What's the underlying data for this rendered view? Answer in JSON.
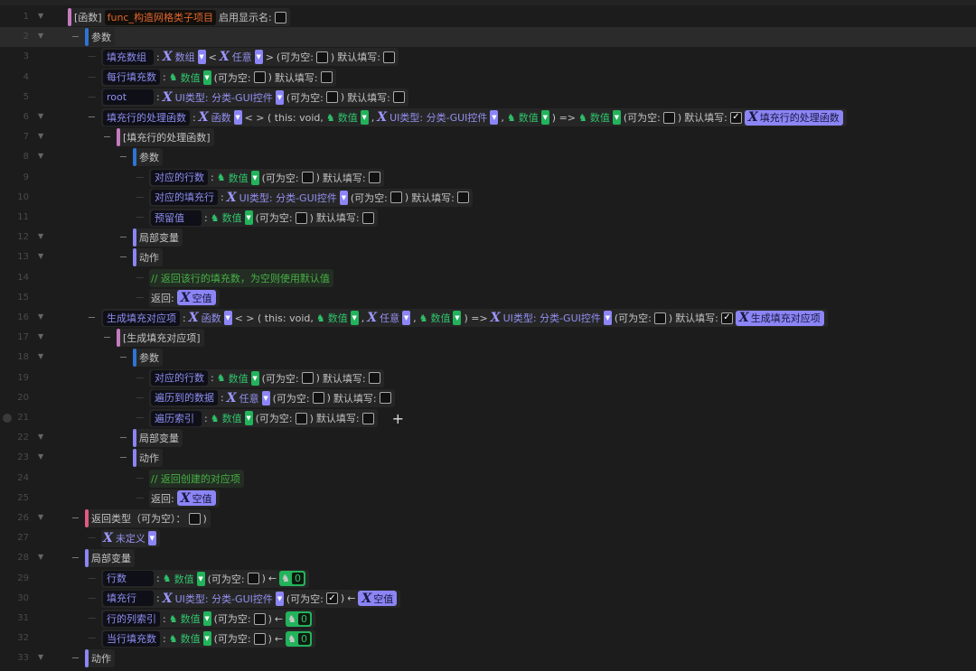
{
  "colors": {
    "pink": "#c57bc0",
    "blue": "#2e74d6",
    "purple": "#8b85f5",
    "red": "#e05a80",
    "accent_x": "#9d97ff",
    "accent_num": "#22b35b",
    "func_name": "#e0672b"
  },
  "rows": [
    {
      "n": "1",
      "lvl": 0,
      "fold": true,
      "bar": "pink",
      "segs": [
        {
          "k": "txt",
          "v": "[函数]"
        },
        {
          "k": "fname",
          "v": "func_构造网格类子项目"
        },
        {
          "k": "txt",
          "v": "启用显示名:"
        },
        {
          "k": "cb"
        }
      ]
    },
    {
      "n": "2",
      "lvl": 1,
      "fold": true,
      "dash": true,
      "hl": true,
      "bar": "blue",
      "segs": [
        {
          "k": "txt",
          "v": "参数"
        }
      ]
    },
    {
      "n": "3",
      "lvl": 2,
      "segs": [
        {
          "k": "name",
          "v": "填充数组"
        },
        {
          "k": "txt",
          "v": ":"
        },
        {
          "k": "x",
          "v": "数组"
        },
        {
          "k": "txt",
          "v": "<"
        },
        {
          "k": "x",
          "v": "任意"
        },
        {
          "k": "txt",
          "v": ">"
        },
        {
          "k": "txt",
          "v": "(可为空:"
        },
        {
          "k": "cb"
        },
        {
          "k": "txt",
          "v": ")"
        },
        {
          "k": "txt",
          "v": "默认填写:"
        },
        {
          "k": "cb"
        }
      ]
    },
    {
      "n": "4",
      "lvl": 2,
      "segs": [
        {
          "k": "name",
          "v": "每行填充数"
        },
        {
          "k": "txt",
          "v": ":"
        },
        {
          "k": "num",
          "v": "数值"
        },
        {
          "k": "txt",
          "v": "(可为空:"
        },
        {
          "k": "cb"
        },
        {
          "k": "txt",
          "v": ")"
        },
        {
          "k": "txt",
          "v": "默认填写:"
        },
        {
          "k": "cb"
        }
      ]
    },
    {
      "n": "5",
      "lvl": 2,
      "segs": [
        {
          "k": "name",
          "v": "root"
        },
        {
          "k": "txt",
          "v": ":"
        },
        {
          "k": "x",
          "v": "UI类型: 分类-GUI控件"
        },
        {
          "k": "txt",
          "v": "(可为空:"
        },
        {
          "k": "cb"
        },
        {
          "k": "txt",
          "v": ")"
        },
        {
          "k": "txt",
          "v": "默认填写:"
        },
        {
          "k": "cb"
        }
      ]
    },
    {
      "n": "6",
      "lvl": 2,
      "fold": true,
      "dash": true,
      "segs": [
        {
          "k": "name",
          "v": "填充行的处理函数"
        },
        {
          "k": "txt",
          "v": ":"
        },
        {
          "k": "x",
          "v": "函数"
        },
        {
          "k": "txt",
          "v": "< > ( this: void,"
        },
        {
          "k": "num",
          "v": "数值"
        },
        {
          "k": "txt",
          "v": ","
        },
        {
          "k": "x",
          "v": "UI类型: 分类-GUI控件"
        },
        {
          "k": "txt",
          "v": ","
        },
        {
          "k": "num",
          "v": "数值"
        },
        {
          "k": "txt",
          "v": ") =>"
        },
        {
          "k": "num",
          "v": "数值"
        },
        {
          "k": "txt",
          "v": "(可为空:"
        },
        {
          "k": "cb"
        },
        {
          "k": "txt",
          "v": ")"
        },
        {
          "k": "txt",
          "v": "默认填写:"
        },
        {
          "k": "cb",
          "checked": true
        },
        {
          "k": "chip",
          "v": "填充行的处理函数"
        }
      ]
    },
    {
      "n": "7",
      "lvl": 3,
      "fold": true,
      "dash": true,
      "bar": "pink",
      "segs": [
        {
          "k": "txt",
          "v": "[填充行的处理函数]"
        }
      ]
    },
    {
      "n": "8",
      "lvl": 4,
      "fold": true,
      "dash": true,
      "bar": "blue",
      "segs": [
        {
          "k": "txt",
          "v": "参数"
        }
      ]
    },
    {
      "n": "9",
      "lvl": 5,
      "segs": [
        {
          "k": "name",
          "v": "对应的行数"
        },
        {
          "k": "txt",
          "v": ":"
        },
        {
          "k": "num",
          "v": "数值"
        },
        {
          "k": "txt",
          "v": "(可为空:"
        },
        {
          "k": "cb"
        },
        {
          "k": "txt",
          "v": ")"
        },
        {
          "k": "txt",
          "v": "默认填写:"
        },
        {
          "k": "cb"
        }
      ]
    },
    {
      "n": "10",
      "lvl": 5,
      "segs": [
        {
          "k": "name",
          "v": "对应的填充行"
        },
        {
          "k": "txt",
          "v": ":"
        },
        {
          "k": "x",
          "v": "UI类型: 分类-GUI控件"
        },
        {
          "k": "txt",
          "v": "(可为空:"
        },
        {
          "k": "cb"
        },
        {
          "k": "txt",
          "v": ")"
        },
        {
          "k": "txt",
          "v": "默认填写:"
        },
        {
          "k": "cb"
        }
      ]
    },
    {
      "n": "11",
      "lvl": 5,
      "segs": [
        {
          "k": "name",
          "v": "预留值"
        },
        {
          "k": "txt",
          "v": ":"
        },
        {
          "k": "num",
          "v": "数值"
        },
        {
          "k": "txt",
          "v": "(可为空:"
        },
        {
          "k": "cb"
        },
        {
          "k": "txt",
          "v": ")"
        },
        {
          "k": "txt",
          "v": "默认填写:"
        },
        {
          "k": "cb"
        }
      ]
    },
    {
      "n": "12",
      "lvl": 4,
      "fold": true,
      "dash": true,
      "bar": "purple",
      "segs": [
        {
          "k": "txt",
          "v": "局部变量"
        }
      ]
    },
    {
      "n": "13",
      "lvl": 4,
      "fold": true,
      "dash": true,
      "bar": "purple",
      "segs": [
        {
          "k": "txt",
          "v": "动作"
        }
      ]
    },
    {
      "n": "14",
      "lvl": 5,
      "comment": true,
      "segs": [
        {
          "k": "comment",
          "v": "// 返回该行的填充数，为空则使用默认值"
        }
      ]
    },
    {
      "n": "15",
      "lvl": 5,
      "segs": [
        {
          "k": "txt",
          "v": "返回:"
        },
        {
          "k": "chip",
          "v": "空值"
        }
      ]
    },
    {
      "n": "16",
      "lvl": 2,
      "fold": true,
      "dash": true,
      "segs": [
        {
          "k": "name",
          "v": "生成填充对应项"
        },
        {
          "k": "txt",
          "v": ":"
        },
        {
          "k": "x",
          "v": "函数"
        },
        {
          "k": "txt",
          "v": "< > ( this: void,"
        },
        {
          "k": "num",
          "v": "数值"
        },
        {
          "k": "txt",
          "v": ","
        },
        {
          "k": "x",
          "v": "任意"
        },
        {
          "k": "txt",
          "v": ","
        },
        {
          "k": "num",
          "v": "数值"
        },
        {
          "k": "txt",
          "v": ") =>"
        },
        {
          "k": "x",
          "v": "UI类型: 分类-GUI控件"
        },
        {
          "k": "txt",
          "v": "(可为空:"
        },
        {
          "k": "cb"
        },
        {
          "k": "txt",
          "v": ")"
        },
        {
          "k": "txt",
          "v": "默认填写:"
        },
        {
          "k": "cb",
          "checked": true
        },
        {
          "k": "chip",
          "v": "生成填充对应项"
        }
      ]
    },
    {
      "n": "17",
      "lvl": 3,
      "fold": true,
      "dash": true,
      "bar": "pink",
      "segs": [
        {
          "k": "txt",
          "v": "[生成填充对应项]"
        }
      ]
    },
    {
      "n": "18",
      "lvl": 4,
      "fold": true,
      "dash": true,
      "bar": "blue",
      "segs": [
        {
          "k": "txt",
          "v": "参数"
        }
      ]
    },
    {
      "n": "19",
      "lvl": 5,
      "segs": [
        {
          "k": "name",
          "v": "对应的行数"
        },
        {
          "k": "txt",
          "v": ":"
        },
        {
          "k": "num",
          "v": "数值"
        },
        {
          "k": "txt",
          "v": "(可为空:"
        },
        {
          "k": "cb"
        },
        {
          "k": "txt",
          "v": ")"
        },
        {
          "k": "txt",
          "v": "默认填写:"
        },
        {
          "k": "cb"
        }
      ]
    },
    {
      "n": "20",
      "lvl": 5,
      "segs": [
        {
          "k": "name",
          "v": "遍历到的数据"
        },
        {
          "k": "txt",
          "v": ":"
        },
        {
          "k": "x",
          "v": "任意"
        },
        {
          "k": "txt",
          "v": "(可为空:"
        },
        {
          "k": "cb"
        },
        {
          "k": "txt",
          "v": ")"
        },
        {
          "k": "txt",
          "v": "默认填写:"
        },
        {
          "k": "cb"
        }
      ]
    },
    {
      "n": "21",
      "lvl": 5,
      "dot": true,
      "plus": "+",
      "segs": [
        {
          "k": "name",
          "v": "遍历索引"
        },
        {
          "k": "txt",
          "v": ":"
        },
        {
          "k": "num",
          "v": "数值"
        },
        {
          "k": "txt",
          "v": "(可为空:"
        },
        {
          "k": "cb"
        },
        {
          "k": "txt",
          "v": ")"
        },
        {
          "k": "txt",
          "v": "默认填写:"
        },
        {
          "k": "cb"
        }
      ]
    },
    {
      "n": "22",
      "lvl": 4,
      "fold": true,
      "dash": true,
      "bar": "purple",
      "segs": [
        {
          "k": "txt",
          "v": "局部变量"
        }
      ]
    },
    {
      "n": "23",
      "lvl": 4,
      "fold": true,
      "dash": true,
      "bar": "purple",
      "segs": [
        {
          "k": "txt",
          "v": "动作"
        }
      ]
    },
    {
      "n": "24",
      "lvl": 5,
      "comment": true,
      "segs": [
        {
          "k": "comment",
          "v": "// 返回创建的对应项"
        }
      ]
    },
    {
      "n": "25",
      "lvl": 5,
      "segs": [
        {
          "k": "txt",
          "v": "返回:"
        },
        {
          "k": "chip",
          "v": "空值"
        }
      ]
    },
    {
      "n": "26",
      "lvl": 1,
      "fold": true,
      "dash": true,
      "bar": "red",
      "segs": [
        {
          "k": "txt",
          "v": "返回类型（可为空）："
        },
        {
          "k": "cb"
        },
        {
          "k": "txt",
          "v": ")"
        }
      ]
    },
    {
      "n": "27",
      "lvl": 2,
      "segs": [
        {
          "k": "x",
          "v": "未定义"
        }
      ]
    },
    {
      "n": "28",
      "lvl": 1,
      "fold": true,
      "dash": true,
      "bar": "purple",
      "segs": [
        {
          "k": "txt",
          "v": "局部变量"
        }
      ]
    },
    {
      "n": "29",
      "lvl": 2,
      "segs": [
        {
          "k": "name",
          "v": "行数"
        },
        {
          "k": "txt",
          "v": ":"
        },
        {
          "k": "num",
          "v": "数值"
        },
        {
          "k": "txt",
          "v": "(可为空:"
        },
        {
          "k": "cb"
        },
        {
          "k": "txt",
          "v": ")"
        },
        {
          "k": "txt",
          "v": "←"
        },
        {
          "k": "vnum",
          "v": "0"
        }
      ]
    },
    {
      "n": "30",
      "lvl": 2,
      "segs": [
        {
          "k": "name",
          "v": "填充行"
        },
        {
          "k": "txt",
          "v": ":"
        },
        {
          "k": "x",
          "v": "UI类型: 分类-GUI控件"
        },
        {
          "k": "txt",
          "v": "(可为空:"
        },
        {
          "k": "cb",
          "checked": true
        },
        {
          "k": "txt",
          "v": ")"
        },
        {
          "k": "txt",
          "v": "←"
        },
        {
          "k": "chip",
          "v": "空值"
        }
      ]
    },
    {
      "n": "31",
      "lvl": 2,
      "segs": [
        {
          "k": "name",
          "v": "行的列索引"
        },
        {
          "k": "txt",
          "v": ":"
        },
        {
          "k": "num",
          "v": "数值"
        },
        {
          "k": "txt",
          "v": "(可为空:"
        },
        {
          "k": "cb"
        },
        {
          "k": "txt",
          "v": ")"
        },
        {
          "k": "txt",
          "v": "←"
        },
        {
          "k": "vnum",
          "v": "0"
        }
      ]
    },
    {
      "n": "32",
      "lvl": 2,
      "segs": [
        {
          "k": "name",
          "v": "当行填充数"
        },
        {
          "k": "txt",
          "v": ":"
        },
        {
          "k": "num",
          "v": "数值"
        },
        {
          "k": "txt",
          "v": "(可为空:"
        },
        {
          "k": "cb"
        },
        {
          "k": "txt",
          "v": ")"
        },
        {
          "k": "txt",
          "v": "←"
        },
        {
          "k": "vnum",
          "v": "0"
        }
      ]
    },
    {
      "n": "33",
      "lvl": 1,
      "fold": true,
      "dash": true,
      "bar": "purple",
      "segs": [
        {
          "k": "txt",
          "v": "动作"
        }
      ]
    }
  ]
}
